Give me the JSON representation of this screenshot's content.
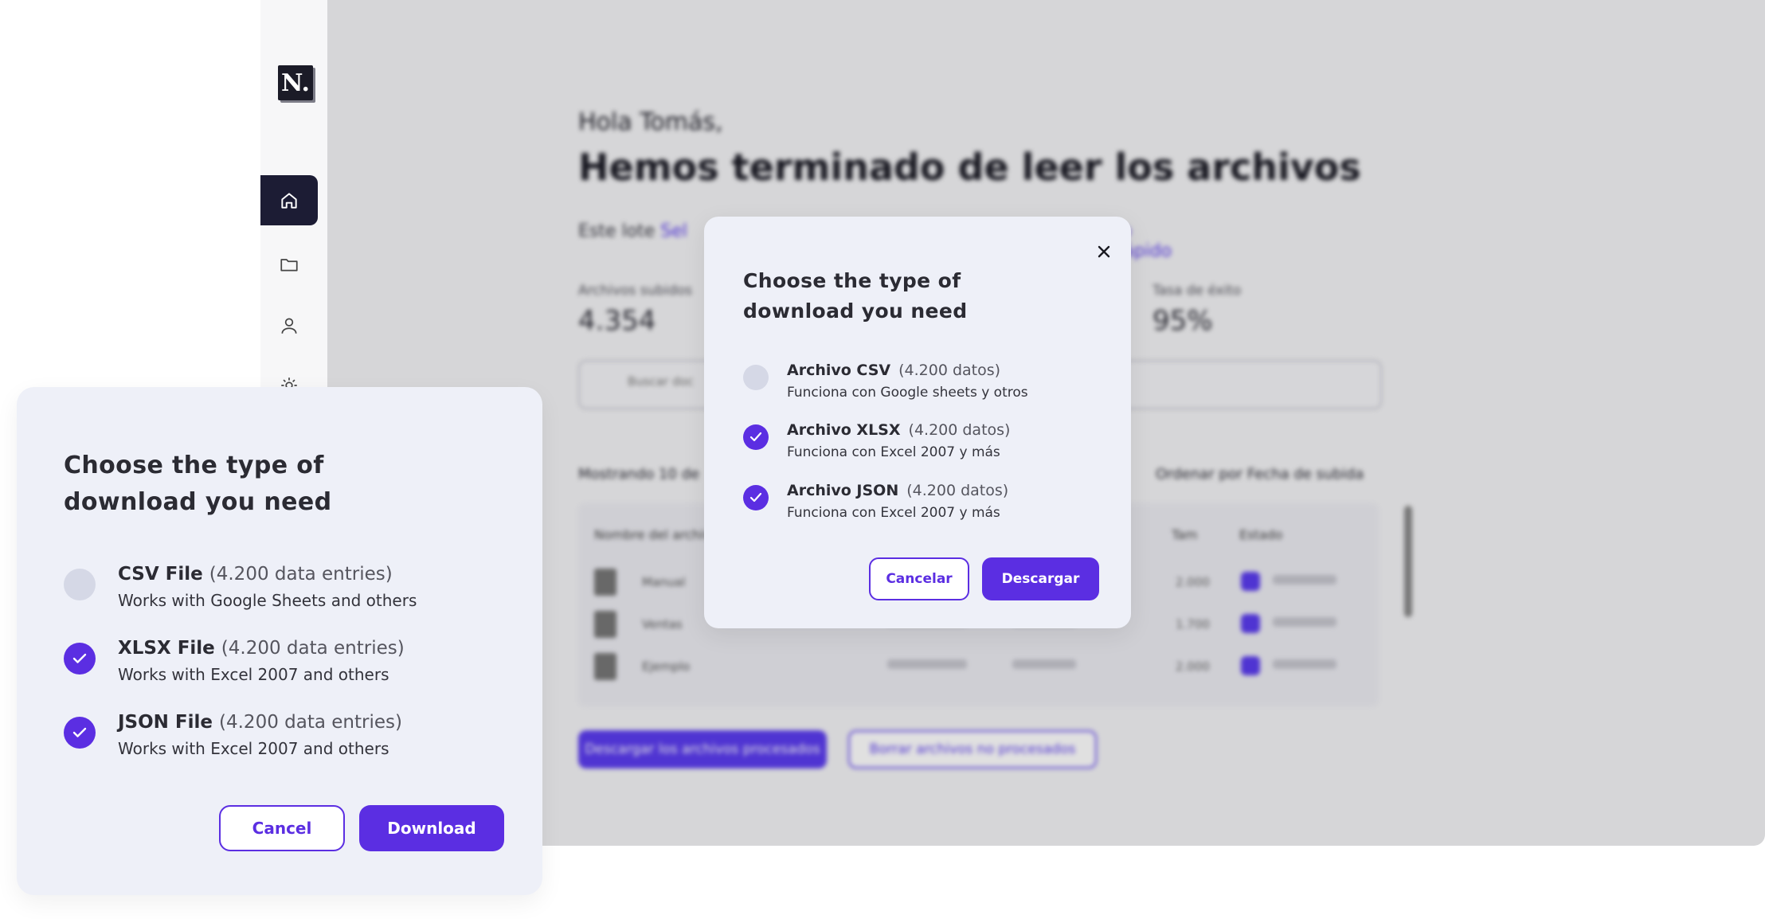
{
  "background": {
    "logo_text": "N.",
    "greeting": "Hola Tomás,",
    "headline": "Hemos terminado de leer los archivos",
    "subtitle_prefix": "Este lote",
    "subtitle_link": "Sel",
    "subtitle_right": "lo rápido",
    "stats": [
      {
        "label": "Archivos subidos",
        "value": "4.354"
      },
      {
        "label": "Tasa de éxito",
        "value": "95%"
      }
    ],
    "search_placeholder": "Buscar doc",
    "list_title": "Mostrando 10 de",
    "sort_label": "Ordenar por Fecha de subida",
    "table_headers": [
      "Nombre del archivo",
      "Tam",
      "Estado"
    ],
    "rows": [
      {
        "name": "Manual",
        "num": "2.000"
      },
      {
        "name": "Ventas",
        "num": "1.700"
      },
      {
        "name": "Ejemplo",
        "num": "2.000"
      }
    ],
    "button_primary": "Descargar los archivos procesados",
    "button_secondary": "Borrar archivos no procesados"
  },
  "center_modal": {
    "title": "Choose the type of download you need",
    "options": [
      {
        "name": "Archivo CSV",
        "count": "(4.200 datos)",
        "desc": "Funciona con Google sheets y otros",
        "checked": false
      },
      {
        "name": "Archivo XLSX",
        "count": "(4.200 datos)",
        "desc": "Funciona con Excel 2007 y más",
        "checked": true
      },
      {
        "name": "Archivo JSON",
        "count": "(4.200 datos)",
        "desc": "Funciona con Excel 2007 y más",
        "checked": true
      }
    ],
    "cancel_label": "Cancelar",
    "download_label": "Descargar"
  },
  "left_card": {
    "title": "Choose the type of download you need",
    "options": [
      {
        "name": "CSV File",
        "count": "(4.200 data entries)",
        "desc": "Works with Google Sheets and others",
        "checked": false
      },
      {
        "name": "XLSX File",
        "count": "(4.200 data entries)",
        "desc": "Works with Excel 2007 and others",
        "checked": true
      },
      {
        "name": "JSON File",
        "count": "(4.200 data entries)",
        "desc": "Works with Excel 2007 and others",
        "checked": true
      }
    ],
    "cancel_label": "Cancel",
    "download_label": "Download"
  },
  "colors": {
    "accent": "#5b2ee2",
    "modal_bg": "#eef0f8",
    "sidebar_active": "#1c1c34"
  }
}
